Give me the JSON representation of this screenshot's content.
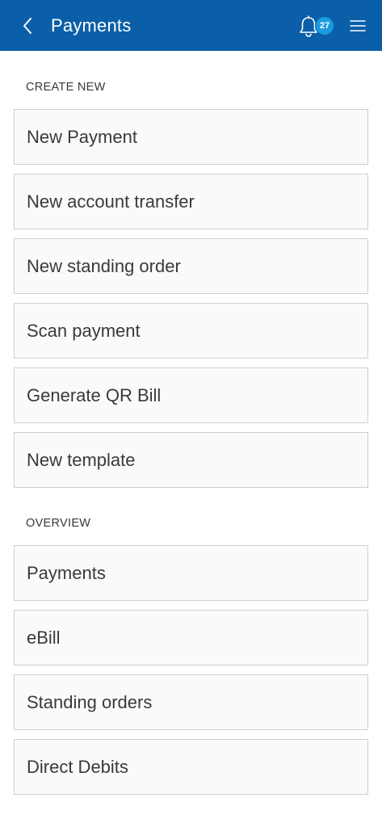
{
  "header": {
    "title": "Payments",
    "notification_count": "27"
  },
  "colors": {
    "header_bg": "#0a5fa8",
    "badge_bg": "#1a9be0"
  },
  "sections": {
    "create_new": {
      "label": "CREATE NEW",
      "items": [
        {
          "label": "New Payment"
        },
        {
          "label": "New account transfer"
        },
        {
          "label": "New standing order"
        },
        {
          "label": "Scan payment"
        },
        {
          "label": "Generate QR Bill"
        },
        {
          "label": "New template"
        }
      ]
    },
    "overview": {
      "label": "OVERVIEW",
      "items": [
        {
          "label": "Payments"
        },
        {
          "label": "eBill"
        },
        {
          "label": "Standing orders"
        },
        {
          "label": "Direct Debits"
        }
      ]
    }
  }
}
